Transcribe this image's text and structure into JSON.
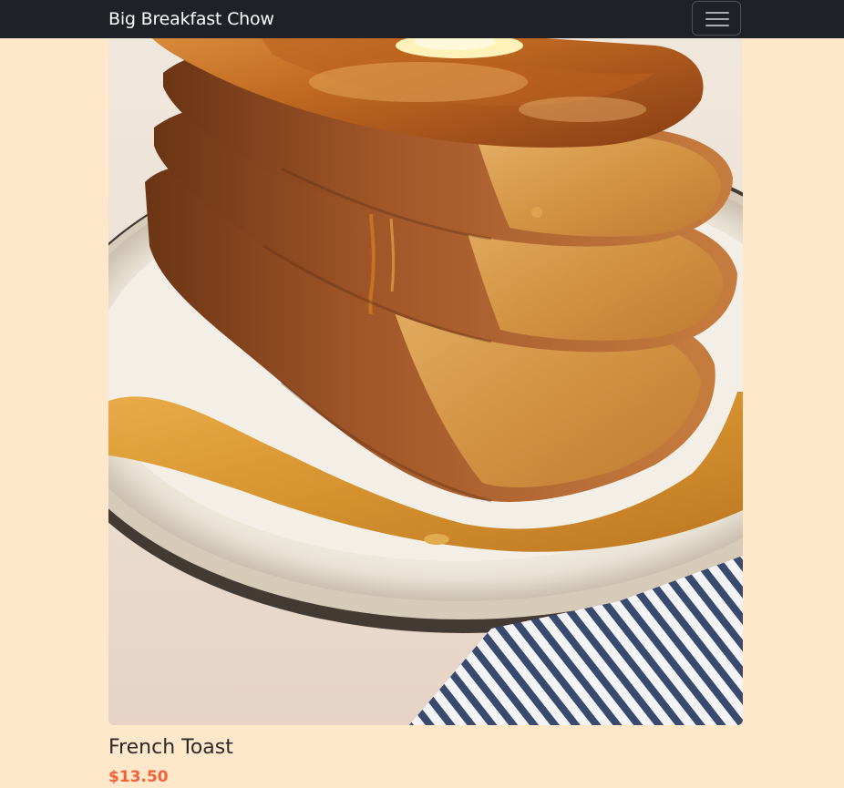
{
  "navbar": {
    "brand": "Big Breakfast Chow",
    "toggler_icon": "hamburger-menu-icon",
    "background": "#1e2227"
  },
  "page": {
    "background": "#ffe8c9"
  },
  "menu_item": {
    "image_subject": "french-toast-stack-photo",
    "name": "French Toast",
    "price": "$13.50",
    "price_color": "#f2623a"
  }
}
